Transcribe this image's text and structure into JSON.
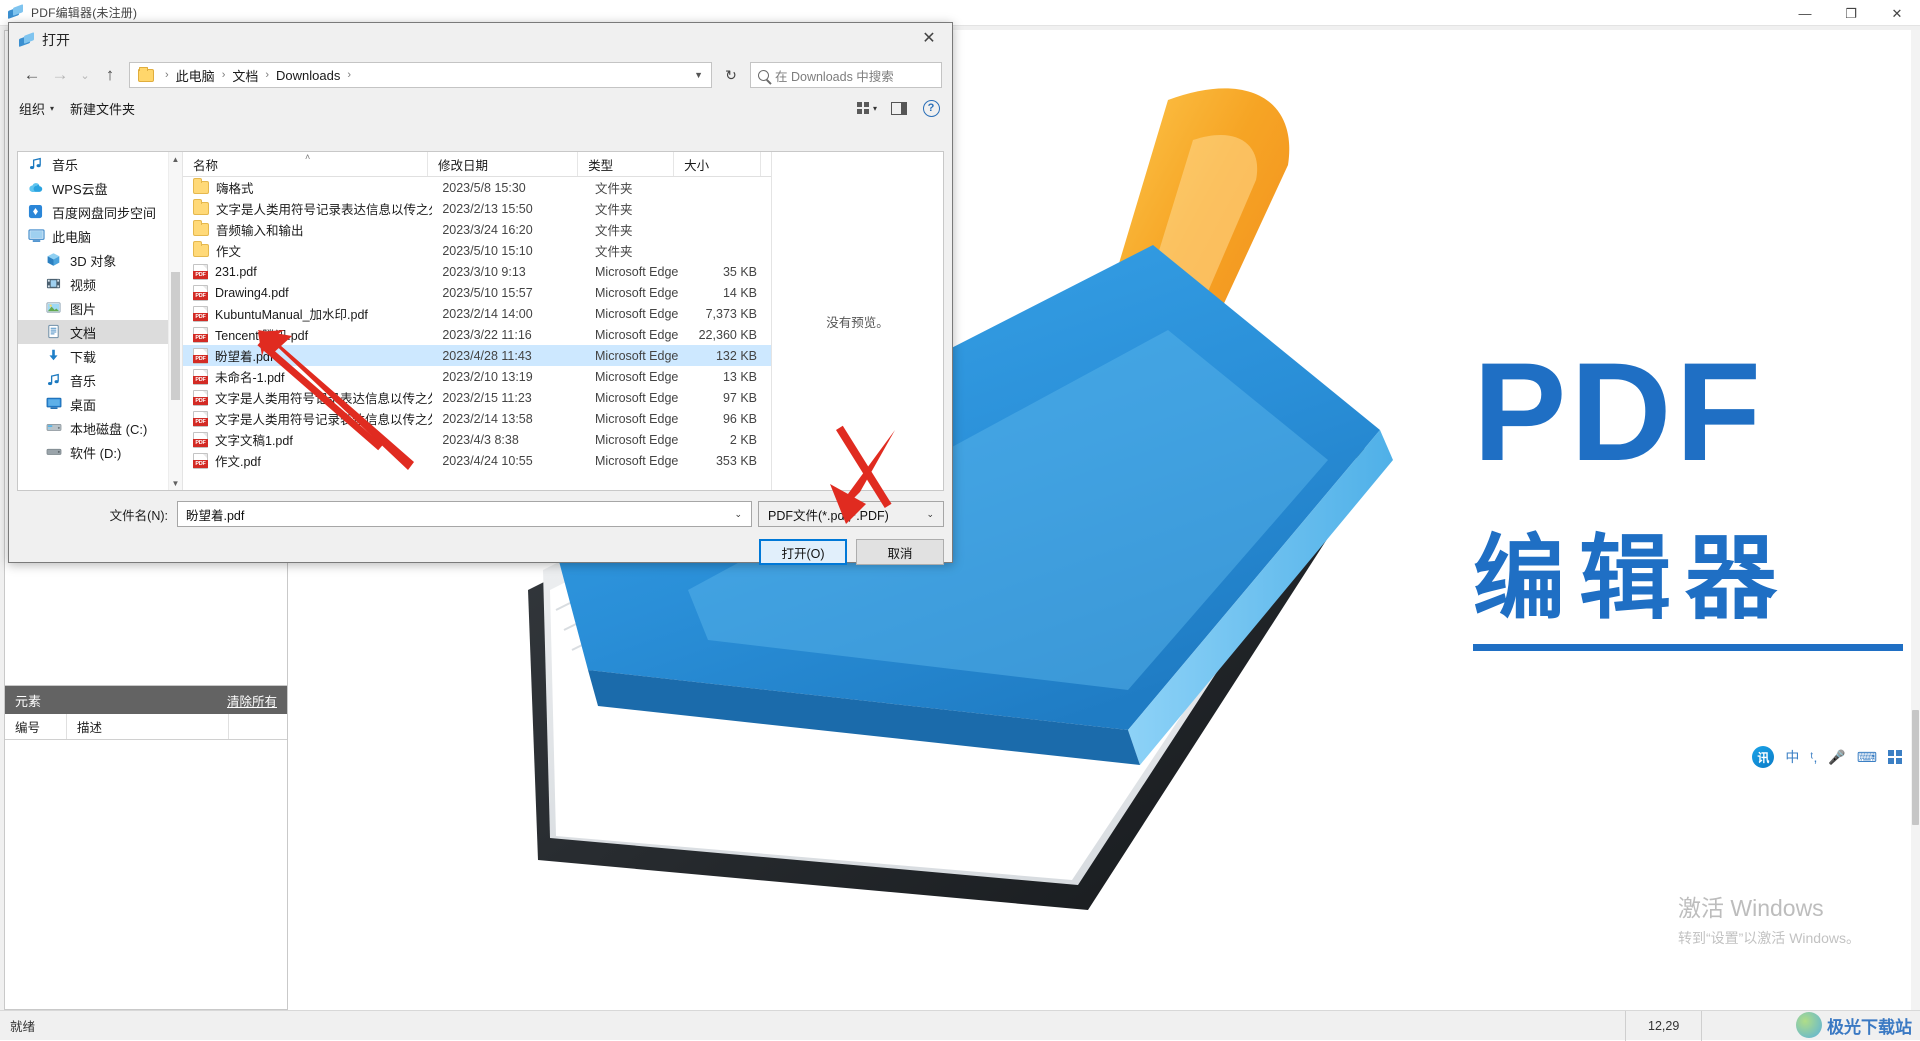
{
  "app": {
    "title": "PDF编辑器(未注册)",
    "icon": "pdf-diamond-icon",
    "minimize": "—",
    "maximize": "❐",
    "close": "✕"
  },
  "left_panel": {
    "elements_header": "元素",
    "clear_all": "清除所有",
    "columns": [
      "编号",
      "描述",
      ""
    ]
  },
  "document": {
    "cover_title_en": "PDF",
    "cover_title_cn": "编辑器",
    "activate_title": "激活 Windows",
    "activate_sub": "转到“设置”以激活 Windows。"
  },
  "ime": {
    "logo": "讯",
    "lang": "中",
    "punct": "ᵗ,",
    "mic": "mic-icon",
    "keyboard": "keyboard-icon",
    "grid": "grid-icon"
  },
  "status_bar": {
    "state": "就绪",
    "coords": "12,29",
    "watermark": "极光下载站",
    "watermark_url": "www.xz7.com"
  },
  "dialog": {
    "title": "打开",
    "icon": "pdf-diamond-icon",
    "close": "✕",
    "nav": {
      "back": "←",
      "forward": "→",
      "recent": "⌄",
      "up": "↑",
      "refresh": "↻",
      "breadcrumb": [
        "此电脑",
        "文档",
        "Downloads"
      ],
      "breadcrumb_sep": "›",
      "search_placeholder": "在 Downloads 中搜索"
    },
    "toolbar": {
      "organize": "组织",
      "new_folder": "新建文件夹",
      "caret": "▾",
      "view_icon": "view-grid-icon",
      "view_caret": "▾",
      "preview_pane_icon": "preview-pane-icon",
      "help_icon": "?"
    },
    "nav_pane": {
      "items": [
        {
          "label": "音乐",
          "icon": "music-note-icon",
          "indent": 0,
          "selected": false
        },
        {
          "label": "WPS云盘",
          "icon": "cloud-icon",
          "indent": 0,
          "selected": false
        },
        {
          "label": "百度网盘同步空间",
          "icon": "baidu-netdisk-icon",
          "indent": 0,
          "selected": false
        },
        {
          "label": "此电脑",
          "icon": "this-pc-icon",
          "indent": 0,
          "selected": false
        },
        {
          "label": "3D 对象",
          "icon": "3d-objects-icon",
          "indent": 1,
          "selected": false
        },
        {
          "label": "视频",
          "icon": "videos-icon",
          "indent": 1,
          "selected": false
        },
        {
          "label": "图片",
          "icon": "pictures-icon",
          "indent": 1,
          "selected": false
        },
        {
          "label": "文档",
          "icon": "documents-icon",
          "indent": 1,
          "selected": true
        },
        {
          "label": "下载",
          "icon": "downloads-icon",
          "indent": 1,
          "selected": false
        },
        {
          "label": "音乐",
          "icon": "music-note-icon",
          "indent": 1,
          "selected": false
        },
        {
          "label": "桌面",
          "icon": "desktop-icon",
          "indent": 1,
          "selected": false
        },
        {
          "label": "本地磁盘 (C:)",
          "icon": "local-disk-icon",
          "indent": 1,
          "selected": false
        },
        {
          "label": "软件 (D:)",
          "icon": "drive-icon",
          "indent": 1,
          "selected": false
        }
      ]
    },
    "file_list": {
      "columns": {
        "name": "名称",
        "date": "修改日期",
        "type": "类型",
        "size": "大小"
      },
      "sort_indicator": "˄",
      "rows": [
        {
          "name": "嗨格式",
          "date": "2023/5/8 15:30",
          "type": "文件夹",
          "size": "",
          "icon": "folder-icon",
          "selected": false
        },
        {
          "name": "文字是人类用符号记录表达信息以传之久...",
          "date": "2023/2/13 15:50",
          "type": "文件夹",
          "size": "",
          "icon": "folder-icon",
          "selected": false
        },
        {
          "name": "音频输入和输出",
          "date": "2023/3/24 16:20",
          "type": "文件夹",
          "size": "",
          "icon": "folder-icon",
          "selected": false
        },
        {
          "name": "作文",
          "date": "2023/5/10 15:10",
          "type": "文件夹",
          "size": "",
          "icon": "folder-icon",
          "selected": false
        },
        {
          "name": "231.pdf",
          "date": "2023/3/10 9:13",
          "type": "Microsoft Edge ...",
          "size": "35 KB",
          "icon": "pdf-icon",
          "selected": false
        },
        {
          "name": "Drawing4.pdf",
          "date": "2023/5/10 15:57",
          "type": "Microsoft Edge ...",
          "size": "14 KB",
          "icon": "pdf-icon",
          "selected": false
        },
        {
          "name": "KubuntuManual_加水印.pdf",
          "date": "2023/2/14 14:00",
          "type": "Microsoft Edge ...",
          "size": "7,373 KB",
          "icon": "pdf-icon",
          "selected": false
        },
        {
          "name": "Tencent 腾讯.pdf",
          "date": "2023/3/22 11:16",
          "type": "Microsoft Edge ...",
          "size": "22,360 KB",
          "icon": "pdf-icon",
          "selected": false
        },
        {
          "name": "盼望着.pdf",
          "date": "2023/4/28 11:43",
          "type": "Microsoft Edge ...",
          "size": "132 KB",
          "icon": "pdf-icon",
          "selected": true
        },
        {
          "name": "未命名-1.pdf",
          "date": "2023/2/10 13:19",
          "type": "Microsoft Edge ...",
          "size": "13 KB",
          "icon": "pdf-icon",
          "selected": false
        },
        {
          "name": "文字是人类用符号记录表达信息以传之久...",
          "date": "2023/2/15 11:23",
          "type": "Microsoft Edge ...",
          "size": "97 KB",
          "icon": "pdf-icon",
          "selected": false
        },
        {
          "name": "文字是人类用符号记录表达信息以传之久...",
          "date": "2023/2/14 13:58",
          "type": "Microsoft Edge ...",
          "size": "96 KB",
          "icon": "pdf-icon",
          "selected": false
        },
        {
          "name": "文字文稿1.pdf",
          "date": "2023/4/3 8:38",
          "type": "Microsoft Edge ...",
          "size": "2 KB",
          "icon": "pdf-icon",
          "selected": false
        },
        {
          "name": "作文.pdf",
          "date": "2023/4/24 10:55",
          "type": "Microsoft Edge ...",
          "size": "353 KB",
          "icon": "pdf-icon",
          "selected": false
        }
      ]
    },
    "preview": {
      "empty_text": "没有预览。"
    },
    "footer": {
      "filename_label": "文件名(N):",
      "filename_value": "盼望着.pdf",
      "filter_value": "PDF文件(*.pdf;*.PDF)",
      "open_button": "打开(O)",
      "cancel_button": "取消",
      "caret": "⌄"
    }
  },
  "colors": {
    "accent": "#0078d7",
    "selection": "#cde8ff",
    "pdf_blue": "#1f6fc4",
    "annotation_red": "#e02b20"
  }
}
